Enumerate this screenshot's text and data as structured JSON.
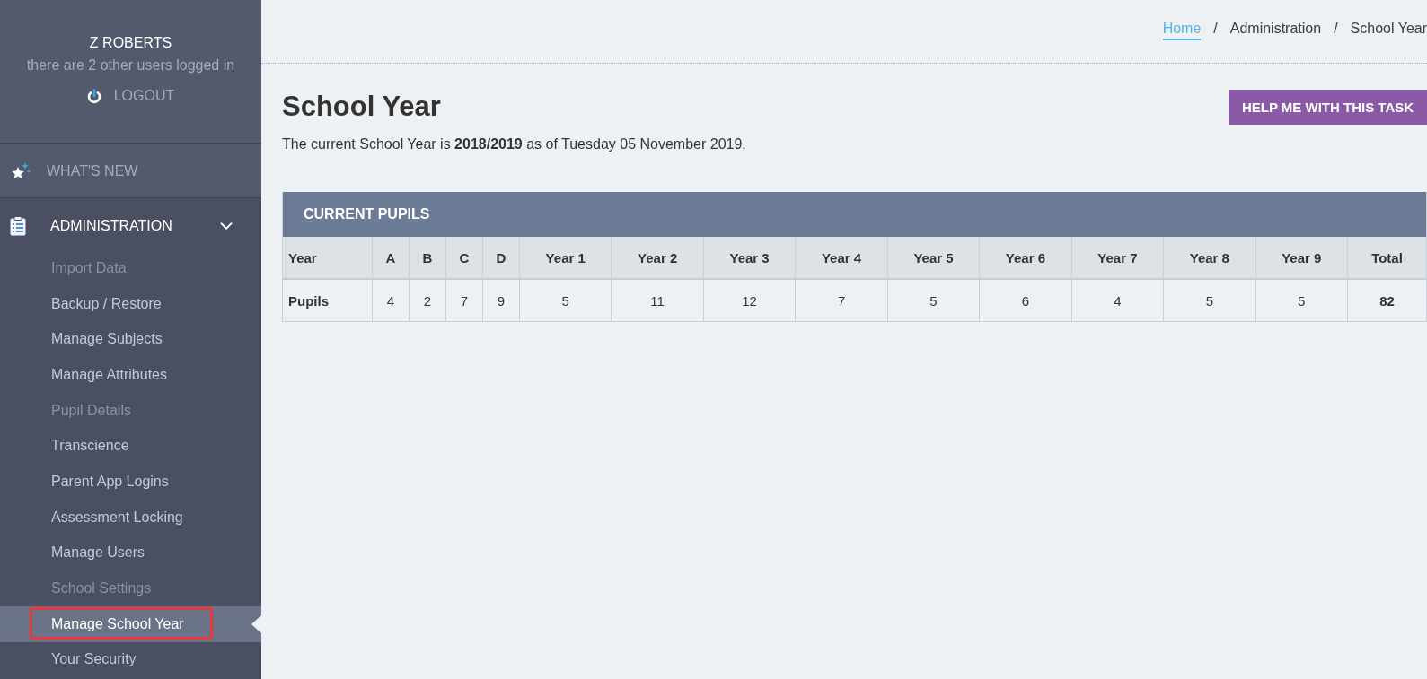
{
  "user": {
    "name": "Z ROBERTS",
    "status": "there are 2 other users logged in",
    "logout": "LOGOUT"
  },
  "nav": [
    {
      "kind": "news",
      "label": "WHAT'S NEW"
    },
    {
      "kind": "section",
      "label": "ADMINISTRATION",
      "expanded": true,
      "children": [
        {
          "label": "Import Data",
          "disabled": true,
          "selected": false,
          "highlighted": false
        },
        {
          "label": "Backup / Restore",
          "disabled": false,
          "selected": false,
          "highlighted": false
        },
        {
          "label": "Manage Subjects",
          "disabled": false,
          "selected": false,
          "highlighted": false
        },
        {
          "label": "Manage Attributes",
          "disabled": false,
          "selected": false,
          "highlighted": false
        },
        {
          "label": "Pupil Details",
          "disabled": true,
          "selected": false,
          "highlighted": false
        },
        {
          "label": "Transcience",
          "disabled": false,
          "selected": false,
          "highlighted": false
        },
        {
          "label": "Parent App Logins",
          "disabled": false,
          "selected": false,
          "highlighted": false
        },
        {
          "label": "Assessment Locking",
          "disabled": false,
          "selected": false,
          "highlighted": false
        },
        {
          "label": "Manage Users",
          "disabled": false,
          "selected": false,
          "highlighted": false
        },
        {
          "label": "School Settings",
          "disabled": true,
          "selected": false,
          "highlighted": false
        },
        {
          "label": "Manage School Year",
          "disabled": false,
          "selected": true,
          "highlighted": true
        },
        {
          "label": "Your Security",
          "disabled": false,
          "selected": false,
          "highlighted": false
        }
      ]
    }
  ],
  "breadcrumb": [
    {
      "kind": "link",
      "label": "Home"
    },
    {
      "kind": "separator",
      "label": "/"
    },
    {
      "kind": "text",
      "label": "Administration"
    },
    {
      "kind": "separator",
      "label": "/"
    },
    {
      "kind": "text",
      "label": "School Year"
    }
  ],
  "page": {
    "title": "School Year",
    "intro": "The current School Year is **2018/2019** as of Tuesday 05 November 2019.",
    "help_button": "HELP ME WITH THIS TASK"
  },
  "table": {
    "title": "CURRENT PUPILS",
    "columns": [
      "Year",
      "A",
      "B",
      "C",
      "D",
      "Year 1",
      "Year 2",
      "Year 3",
      "Year 4",
      "Year 5",
      "Year 6",
      "Year 7",
      "Year 8",
      "Year 9",
      "Total"
    ],
    "rows": [
      {
        "cells": [
          "Pupils",
          "4",
          "2",
          "7",
          "9",
          "5",
          "11",
          "12",
          "7",
          "5",
          "6",
          "4",
          "5",
          "5",
          "82"
        ]
      }
    ]
  }
}
